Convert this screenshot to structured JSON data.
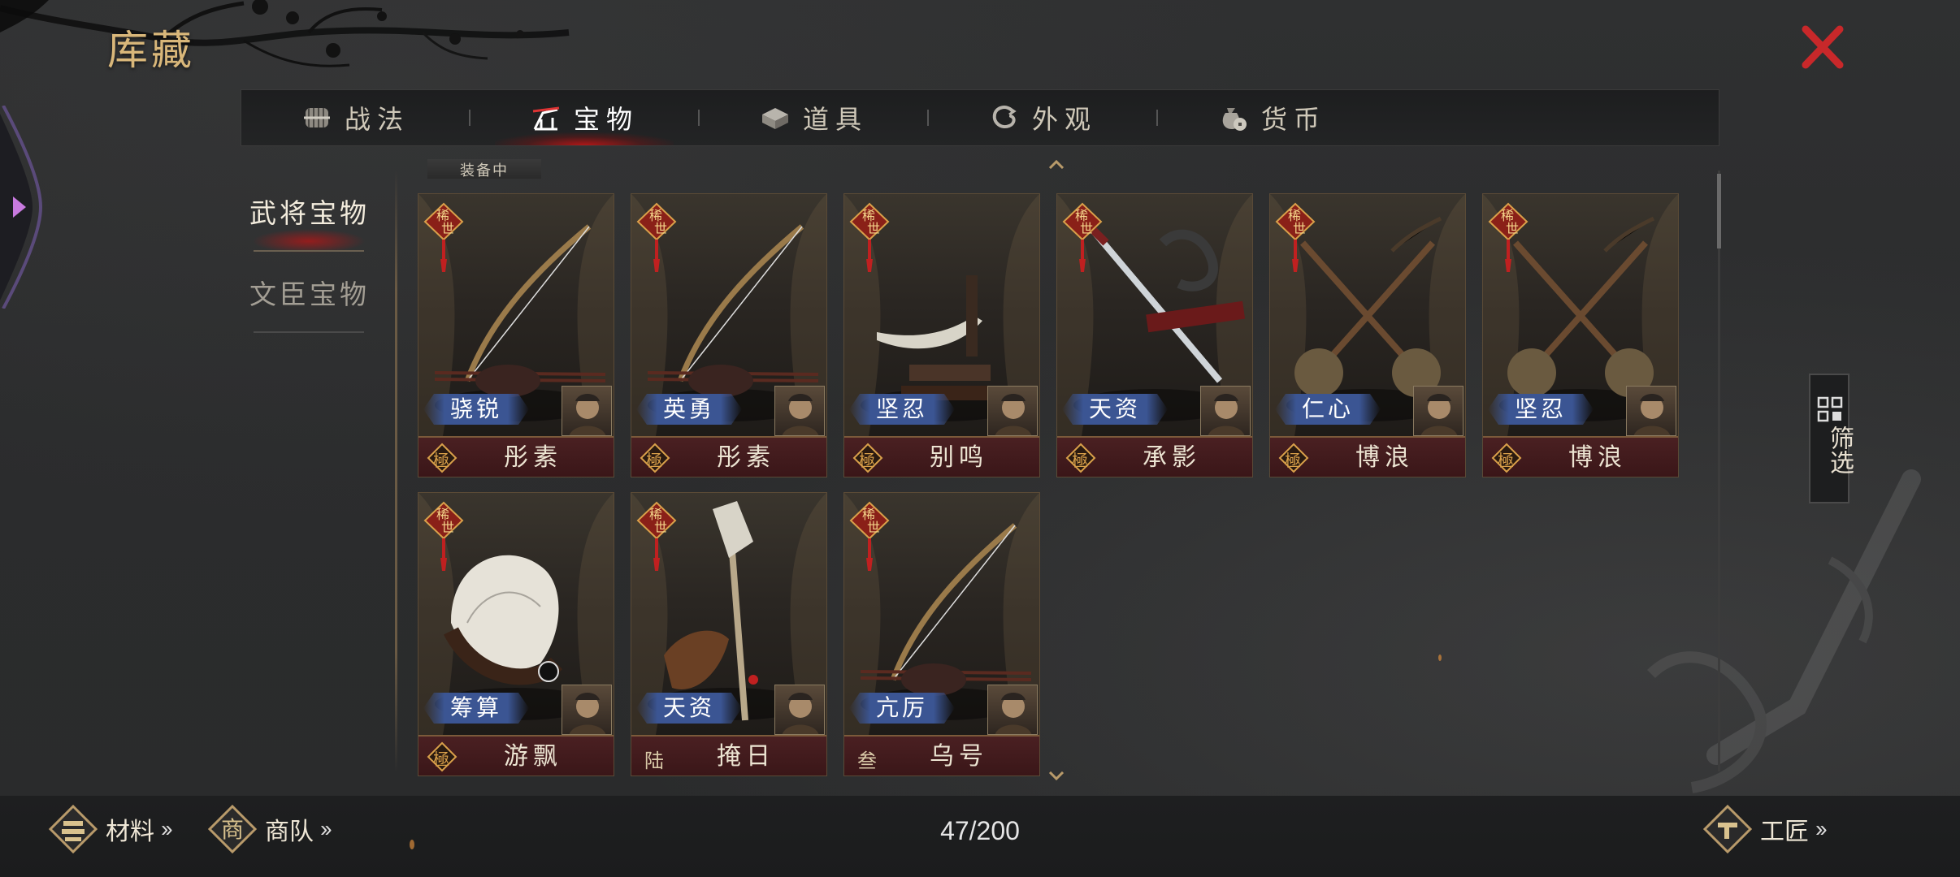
{
  "header": {
    "title": "库藏"
  },
  "tabs": [
    {
      "label": "战法",
      "icon": "scroll-bundle-icon",
      "active": false
    },
    {
      "label": "宝物",
      "icon": "bow-rack-icon",
      "active": true
    },
    {
      "label": "道具",
      "icon": "chest-icon",
      "active": false
    },
    {
      "label": "外观",
      "icon": "swirl-icon",
      "active": false
    },
    {
      "label": "货币",
      "icon": "money-bag-icon",
      "active": false
    }
  ],
  "subnav": [
    {
      "label": "武将宝物",
      "active": true
    },
    {
      "label": "文臣宝物",
      "active": false
    }
  ],
  "equipped_strip": "装备中",
  "items": [
    {
      "rarity": "稀世",
      "trait": "骁锐",
      "grade": "極",
      "name": "彤素",
      "art": "bow"
    },
    {
      "rarity": "稀世",
      "trait": "英勇",
      "grade": "極",
      "name": "彤素",
      "art": "bow"
    },
    {
      "rarity": "稀世",
      "trait": "坚忍",
      "grade": "極",
      "name": "别鸣",
      "art": "blade"
    },
    {
      "rarity": "稀世",
      "trait": "天资",
      "grade": "極",
      "name": "承影",
      "art": "sword"
    },
    {
      "rarity": "稀世",
      "trait": "仁心",
      "grade": "極",
      "name": "博浪",
      "art": "hammers"
    },
    {
      "rarity": "稀世",
      "trait": "坚忍",
      "grade": "極",
      "name": "博浪",
      "art": "hammers"
    },
    {
      "rarity": "稀世",
      "trait": "筹算",
      "grade": "極",
      "name": "游飘",
      "art": "fan"
    },
    {
      "rarity": "稀世",
      "trait": "天资",
      "grade": "陆",
      "name": "掩日",
      "art": "halberd"
    },
    {
      "rarity": "稀世",
      "trait": "亢厉",
      "grade": "叁",
      "name": "乌号",
      "art": "bow2"
    }
  ],
  "filter": {
    "label": "筛选",
    "icon": "grid-icon"
  },
  "footer": {
    "materials": "材料",
    "caravan": "商队",
    "caravan_icon_char": "商",
    "craftsman": "工匠",
    "count": "47/200"
  },
  "colors": {
    "title_gold": "#d9b77a",
    "close_red": "#c8282a",
    "active_glow": "#c81414",
    "trait_blue": "#3b5593",
    "footer_maroon": "#4a2022"
  }
}
